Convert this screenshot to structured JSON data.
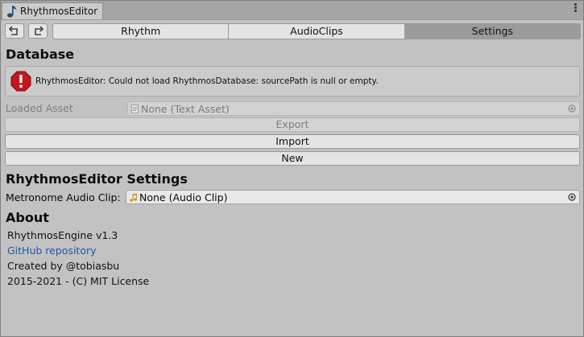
{
  "tab": {
    "title": "RhythmosEditor",
    "icon": "music-note-icon"
  },
  "toolbar": {
    "undo_icon": "undo-icon",
    "redo_icon": "redo-icon",
    "tabs": [
      {
        "label": "Rhythm",
        "active": false
      },
      {
        "label": "AudioClips",
        "active": false
      },
      {
        "label": "Settings",
        "active": true
      }
    ]
  },
  "database": {
    "heading": "Database",
    "error": "RhythmosEditor: Could not load RhythmosDatabase: sourcePath is null or empty.",
    "error_icon": "error-stop-icon",
    "loaded_asset_label": "Loaded Asset",
    "loaded_asset_value": "None (Text Asset)",
    "export_label": "Export",
    "import_label": "Import",
    "new_label": "New"
  },
  "settings": {
    "heading": "RhythmosEditor Settings",
    "metronome_label": "Metronome Audio Clip:",
    "metronome_value": "None (Audio Clip)"
  },
  "about": {
    "heading": "About",
    "version": "RhythmosEngine v1.3",
    "repo_link": "GitHub repository",
    "author": "Created by @tobiasbu",
    "license": "2015-2021 - (C) MIT License"
  },
  "colors": {
    "accent_link": "#2256a4",
    "active_tab": "#9b9b9b",
    "error_red": "#c4161c"
  }
}
